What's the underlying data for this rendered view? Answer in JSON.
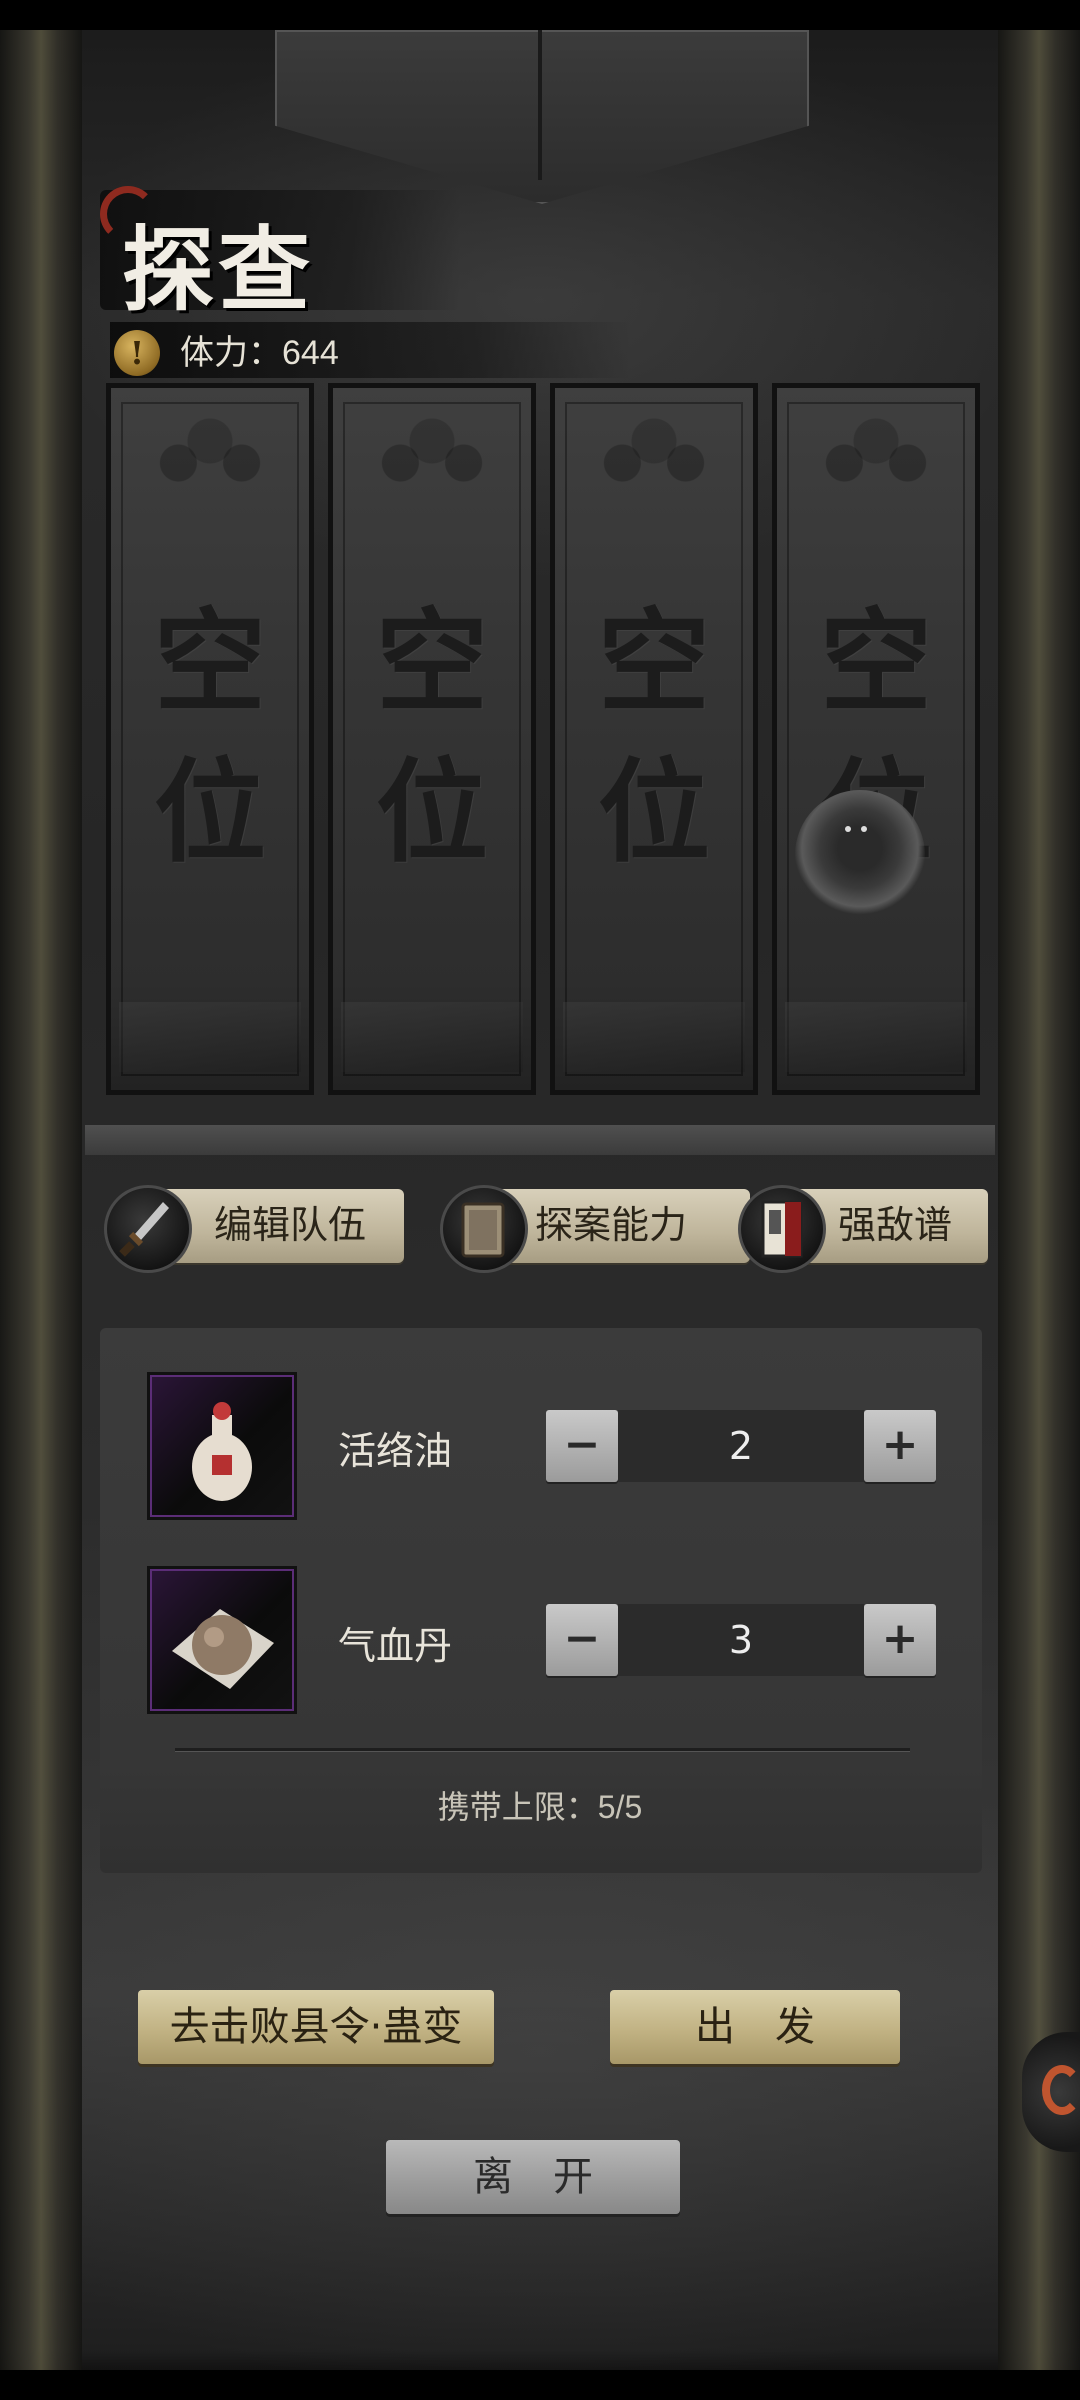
{
  "header": {
    "title": "探查",
    "stamina_label": "体力：644",
    "stamina_icon": "exclamation-coin-icon"
  },
  "slots": [
    {
      "top": "空",
      "bottom": "位"
    },
    {
      "top": "空",
      "bottom": "位"
    },
    {
      "top": "空",
      "bottom": "位"
    },
    {
      "top": "空",
      "bottom": "位"
    }
  ],
  "actions": {
    "edit_team": "编辑队伍",
    "investigation_ability": "探案能力",
    "enemy_book": "强敌谱"
  },
  "items": [
    {
      "name": "活络油",
      "quantity": "2",
      "icon": "medicine-bottle-icon"
    },
    {
      "name": "气血丹",
      "quantity": "3",
      "icon": "pill-icon"
    }
  ],
  "stepper": {
    "minus": "−",
    "plus": "+"
  },
  "carry_limit": "携带上限：5/5",
  "buttons": {
    "defeat_target": "去击败县令·蛊变",
    "depart": "出　发",
    "leave": "离　开"
  },
  "colors": {
    "accent_red": "#8e2a1f",
    "button_gold": "#c1b283",
    "item_purple": "#5b2d77"
  }
}
